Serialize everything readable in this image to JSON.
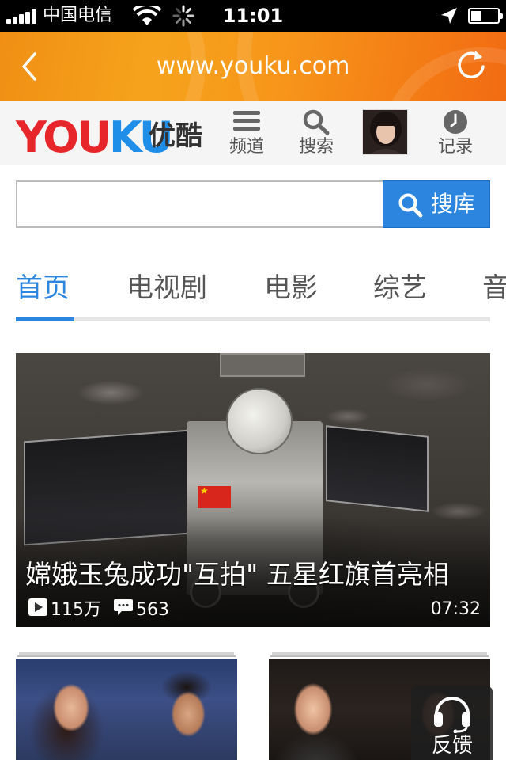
{
  "status_bar": {
    "carrier": "中国电信",
    "time": "11:01"
  },
  "browser": {
    "url": "www.youku.com"
  },
  "header": {
    "logo_text": "YOUKU",
    "logo_cn": "优酷",
    "channels_label": "频道",
    "search_label": "搜索",
    "history_label": "记录"
  },
  "search": {
    "placeholder": "",
    "button_label": "搜库"
  },
  "tabs": [
    {
      "label": "首页",
      "active": true
    },
    {
      "label": "电视剧",
      "active": false
    },
    {
      "label": "电影",
      "active": false
    },
    {
      "label": "综艺",
      "active": false
    },
    {
      "label": "音",
      "active": false
    }
  ],
  "featured": {
    "title": "嫦娥玉兔成功\"互拍\" 五星红旗首亮相",
    "plays": "115万",
    "comments": "563",
    "duration": "07:32"
  },
  "feedback": {
    "label": "反馈"
  },
  "colors": {
    "brand_orange": "#f7961a",
    "accent_blue": "#2c86e0",
    "logo_red": "#e6262b",
    "logo_blue": "#1f8ee8"
  }
}
